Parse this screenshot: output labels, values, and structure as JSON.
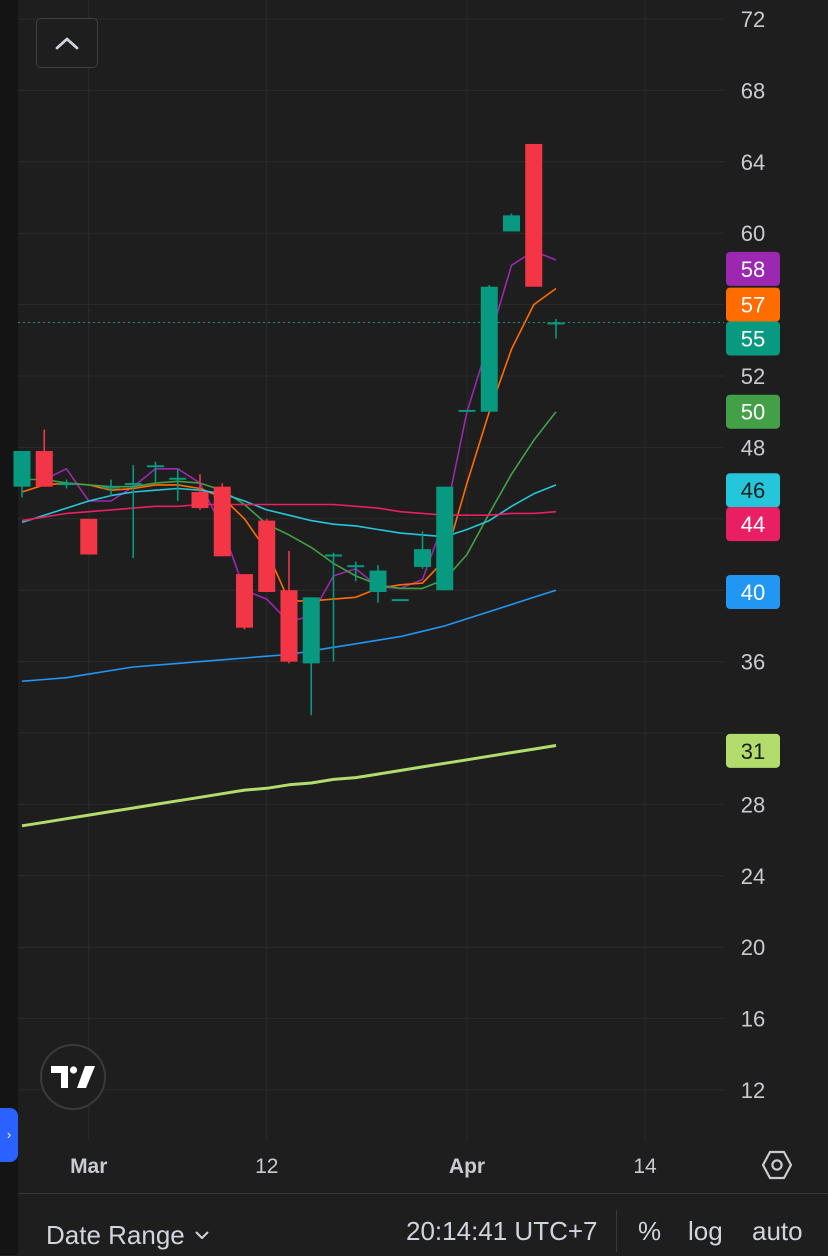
{
  "colors": {
    "background": "#1e1e1e",
    "grid": "#2b2b2b",
    "axis_text": "#c9cbd1",
    "up": "#089981",
    "down": "#f23645",
    "ma_purple": "#9c27b0",
    "ma_orange": "#ff6d00",
    "ma_green": "#43a047",
    "ma_cyan": "#26c6da",
    "ma_red": "#e91e63",
    "ma_blue": "#2196f3",
    "ma_lime": "#b2dd6c"
  },
  "icons": {
    "collapse": "chevron-up-icon",
    "logo": "tradingview-logo-icon",
    "settings": "hexagon-settings-icon",
    "side_toggle": "chevron-right-icon",
    "date_range": "chevron-down-icon"
  },
  "side_toggle_glyph": "›",
  "bottom_bar": {
    "date_range_label": "Date Range",
    "clock": "20:14:41 UTC+7",
    "percent_label": "%",
    "log_label": "log",
    "auto_label": "auto"
  },
  "chart_data": {
    "type": "candlestick",
    "x_tick_labels": [
      "Mar",
      "12",
      "Apr",
      "14"
    ],
    "y_ticks": [
      12,
      16,
      20,
      24,
      28,
      32,
      36,
      40,
      44,
      48,
      52,
      56,
      60,
      64,
      68,
      72
    ],
    "y_tick_labels": [
      "12",
      "16",
      "20",
      "24",
      "28",
      "",
      "36",
      "",
      "",
      "48",
      "52",
      "",
      "60",
      "64",
      "68",
      "72"
    ],
    "ylim": [
      9.3,
      73.5
    ],
    "grid": true,
    "last_price": 55,
    "candles": [
      {
        "open": 45.8,
        "high": 47.8,
        "low": 45.2,
        "close": 47.8
      },
      {
        "open": 47.8,
        "high": 49,
        "low": 45.8,
        "close": 45.8
      },
      {
        "open": 45.9,
        "high": 46.2,
        "low": 45.7,
        "close": 46
      },
      {
        "open": 44,
        "high": 44,
        "low": 42,
        "close": 42
      },
      {
        "open": 45.8,
        "high": 46.2,
        "low": 45.3,
        "close": 45.8
      },
      {
        "open": 46,
        "high": 47,
        "low": 41.8,
        "close": 46
      },
      {
        "open": 47,
        "high": 47.2,
        "low": 46,
        "close": 47
      },
      {
        "open": 46.3,
        "high": 46.8,
        "low": 45,
        "close": 46.3
      },
      {
        "open": 45.5,
        "high": 46.5,
        "low": 44.5,
        "close": 44.6
      },
      {
        "open": 45.8,
        "high": 46,
        "low": 41.9,
        "close": 41.9
      },
      {
        "open": 40.9,
        "high": 40.9,
        "low": 37.8,
        "close": 37.9
      },
      {
        "open": 43.9,
        "high": 44,
        "low": 39.9,
        "close": 39.9
      },
      {
        "open": 40,
        "high": 42.2,
        "low": 35.9,
        "close": 36
      },
      {
        "open": 35.9,
        "high": 39.6,
        "low": 33,
        "close": 39.6
      },
      {
        "open": 42,
        "high": 42.1,
        "low": 36,
        "close": 42
      },
      {
        "open": 41.4,
        "high": 41.6,
        "low": 40.5,
        "close": 41.4
      },
      {
        "open": 39.9,
        "high": 41.4,
        "low": 39.3,
        "close": 41.1
      },
      {
        "open": 39.5,
        "high": 39.5,
        "low": 39.5,
        "close": 39.5
      },
      {
        "open": 41.3,
        "high": 43.3,
        "low": 41.2,
        "close": 42.3
      },
      {
        "open": 40,
        "high": 45.8,
        "low": 40,
        "close": 45.8
      },
      {
        "open": 50.1,
        "high": 50.1,
        "low": 50.1,
        "close": 50.1
      },
      {
        "open": 50,
        "high": 57.1,
        "low": 50,
        "close": 57
      },
      {
        "open": 60.1,
        "high": 61.1,
        "low": 60.1,
        "close": 61
      },
      {
        "open": 65,
        "high": 65,
        "low": 57,
        "close": 57
      },
      {
        "open": 55,
        "high": 55.2,
        "low": 54.1,
        "close": 55
      }
    ],
    "series": [
      {
        "name": "",
        "color": "#9c27b0",
        "label_value": "58",
        "values": [
          null,
          46.2,
          46.8,
          45,
          45,
          45.8,
          46.8,
          46.8,
          46,
          43.5,
          40,
          39.5,
          38.2,
          38.6,
          40.8,
          41.2,
          40.2,
          40.1,
          40.6,
          44,
          50,
          54,
          58.2,
          59,
          58.5
        ]
      },
      {
        "name": "",
        "color": "#ff6d00",
        "label_value": "57",
        "values": [
          45.5,
          45.9,
          46,
          45.9,
          45.6,
          45.7,
          45.9,
          45.9,
          45.7,
          45.2,
          44,
          42.2,
          39.4,
          39.4,
          39.5,
          39.6,
          40.1,
          40.3,
          40.4,
          41.7,
          46,
          50,
          53.5,
          56,
          56.9
        ]
      },
      {
        "name": "",
        "color": "#43a047",
        "label_value": "50",
        "values": [
          46.2,
          46.2,
          46,
          45.9,
          45.8,
          45.8,
          46,
          46.1,
          46,
          45.6,
          44.8,
          43.7,
          43.1,
          42.4,
          41.5,
          40.8,
          40.3,
          40.1,
          40.1,
          40.6,
          42,
          44.3,
          46.5,
          48.4,
          50
        ]
      },
      {
        "name": "",
        "color": "#26c6da",
        "label_value": "46",
        "values": [
          43.8,
          44.2,
          44.6,
          45,
          45.3,
          45.5,
          45.6,
          45.7,
          45.6,
          45.4,
          45,
          44.5,
          44.2,
          43.9,
          43.7,
          43.6,
          43.4,
          43.2,
          43.1,
          43,
          43.4,
          43.9,
          44.7,
          45.4,
          45.9
        ]
      },
      {
        "name": "",
        "color": "#e91e63",
        "label_value": "44",
        "values": [
          43.9,
          44.1,
          44.3,
          44.4,
          44.5,
          44.6,
          44.7,
          44.7,
          44.8,
          44.8,
          44.8,
          44.8,
          44.8,
          44.8,
          44.8,
          44.7,
          44.6,
          44.4,
          44.3,
          44.2,
          44.2,
          44.2,
          44.3,
          44.3,
          44.4
        ]
      },
      {
        "name": "",
        "color": "#2196f3",
        "label_value": "40",
        "values": [
          34.9,
          35,
          35.1,
          35.3,
          35.5,
          35.7,
          35.8,
          35.9,
          36,
          36.1,
          36.2,
          36.3,
          36.4,
          36.6,
          36.8,
          37,
          37.2,
          37.4,
          37.7,
          38,
          38.4,
          38.8,
          39.2,
          39.6,
          40
        ]
      },
      {
        "name": "",
        "color": "#b2dd6c",
        "label_value": "31",
        "values": [
          26.8,
          27,
          27.2,
          27.4,
          27.6,
          27.8,
          28,
          28.2,
          28.4,
          28.6,
          28.8,
          28.9,
          29.1,
          29.2,
          29.4,
          29.5,
          29.7,
          29.9,
          30.1,
          30.3,
          30.5,
          30.7,
          30.9,
          31.1,
          31.3
        ]
      }
    ],
    "price_labels": [
      {
        "value": 58,
        "text": "58",
        "bg": "#9c27b0",
        "fg": "#ffffff"
      },
      {
        "value": 56,
        "text": "57",
        "bg": "#ff6d00",
        "fg": "#ffffff"
      },
      {
        "value": 54.1,
        "text": "55",
        "bg": "#089981",
        "fg": "#ffffff"
      },
      {
        "value": 50,
        "text": "50",
        "bg": "#43a047",
        "fg": "#ffffff"
      },
      {
        "value": 45.6,
        "text": "46",
        "bg": "#26c6da",
        "fg": "#1e1e1e"
      },
      {
        "value": 43.7,
        "text": "44",
        "bg": "#e91e63",
        "fg": "#ffffff"
      },
      {
        "value": 39.9,
        "text": "40",
        "bg": "#2196f3",
        "fg": "#ffffff"
      },
      {
        "value": 31,
        "text": "31",
        "bg": "#b2dd6c",
        "fg": "#1e1e1e"
      }
    ]
  }
}
